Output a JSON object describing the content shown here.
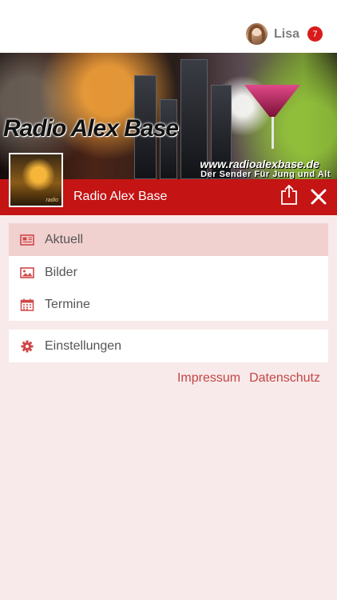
{
  "colors": {
    "accent": "#c41414",
    "active_row": "#f1d0d0",
    "background": "#f8eaea",
    "link": "#c44545",
    "badge": "#d81c1c"
  },
  "user": {
    "name": "Lisa",
    "notification_count": "7",
    "avatar_icon": "avatar-photo"
  },
  "banner": {
    "title": "Radio Alex Base",
    "url": "www.radioalexbase.de",
    "slogan": "Der Sender Für Jung und Alt"
  },
  "station": {
    "name": "Radio Alex Base",
    "share_icon": "share-icon",
    "close_icon": "close-icon"
  },
  "menu": {
    "items": [
      {
        "label": "Aktuell",
        "icon": "newspaper-icon",
        "active": true
      },
      {
        "label": "Bilder",
        "icon": "image-icon",
        "active": false
      },
      {
        "label": "Termine",
        "icon": "calendar-icon",
        "active": false
      }
    ],
    "settings": {
      "label": "Einstellungen",
      "icon": "gear-icon"
    }
  },
  "footer_links": {
    "impressum": "Impressum",
    "datenschutz": "Datenschutz"
  }
}
